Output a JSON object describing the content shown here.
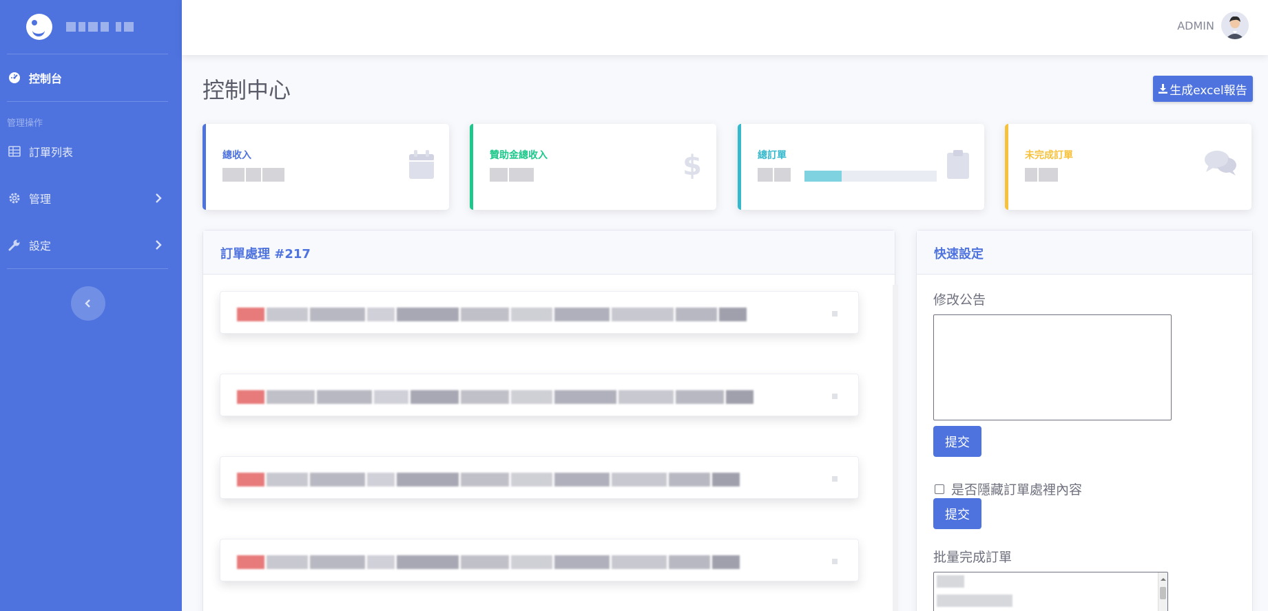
{
  "sidebar": {
    "items": [
      {
        "label": "控制台",
        "icon": "dashboard-icon"
      },
      {
        "label": "訂單列表",
        "icon": "table-icon"
      },
      {
        "label": "管理",
        "icon": "gear-icon"
      },
      {
        "label": "設定",
        "icon": "wrench-icon"
      }
    ],
    "heading": "管理操作"
  },
  "topbar": {
    "user_name": "ADMIN"
  },
  "page": {
    "title": "控制中心",
    "excel_button": "生成excel報告"
  },
  "stats": [
    {
      "label": "總收入",
      "color": "#4e73df",
      "icon": "calendar-icon"
    },
    {
      "label": "贊助金總收入",
      "color": "#1cc88a",
      "icon": "dollar-icon"
    },
    {
      "label": "總訂單",
      "color": "#36b9cc",
      "icon": "clipboard-icon",
      "progress_fraction": 0.28
    },
    {
      "label": "未完成訂單",
      "color": "#f6c23e",
      "icon": "comments-icon"
    }
  ],
  "orders": {
    "title": "訂單處理 #217"
  },
  "quick_settings": {
    "title": "快速設定",
    "announcement_label": "修改公告",
    "submit_label": "提交",
    "hide_label": "是否隱藏訂單處裡內容",
    "submit_label_2": "提交",
    "batch_label": "批量完成訂單"
  },
  "colors": {
    "primary": "#4e73df",
    "success": "#1cc88a",
    "info": "#36b9cc",
    "warning": "#f6c23e"
  }
}
